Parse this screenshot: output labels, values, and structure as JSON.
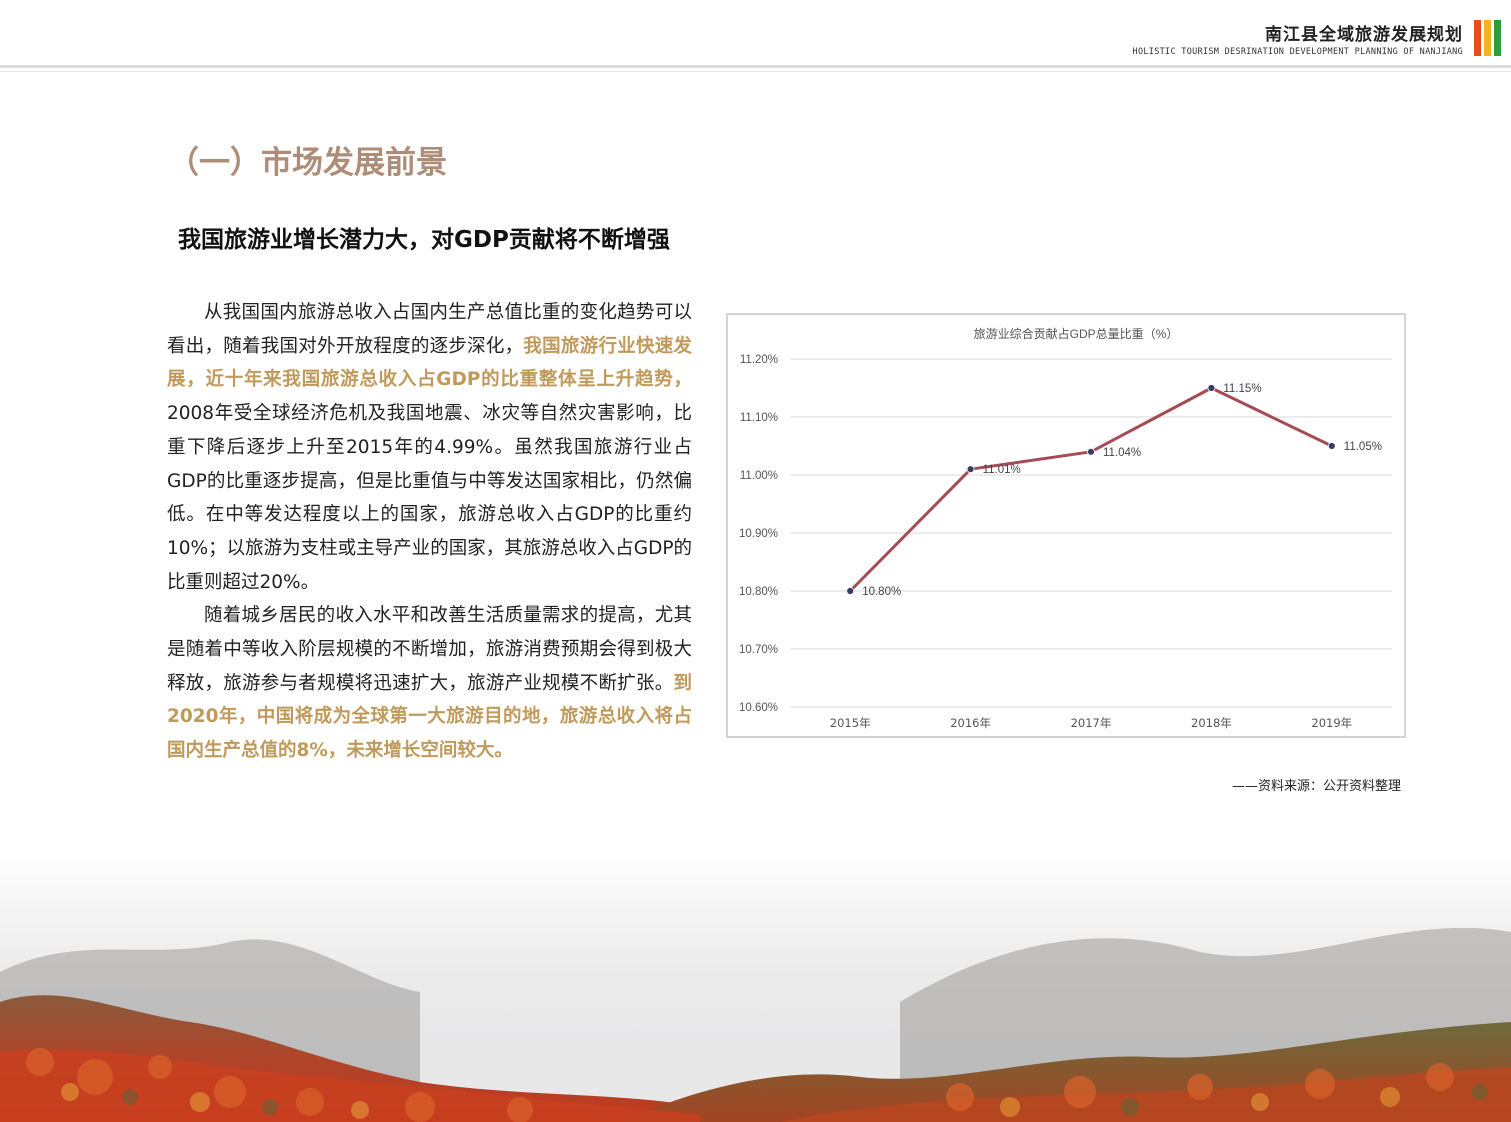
{
  "header": {
    "title": "南江县全域旅游发展规划",
    "subtitle": "HOLISTIC TOURISM DESRINATION DEVELOPMENT PLANNING OF NANJIANG",
    "bar_colors": [
      "#e74c1c",
      "#f4b120",
      "#2e9e3a"
    ]
  },
  "section_title": "（一）市场发展前景",
  "subheading": "我国旅游业增长潜力大，对GDP贡献将不断增强",
  "paragraph1": {
    "part1": "从我国国内旅游总收入占国内生产总值比重的变化趋势可以看出，随着我国对外开放程度的逐步深化，",
    "highlight": "我国旅游行业快速发展，近十年来我国旅游总收入占GDP的比重整体呈上升趋势，",
    "part2": "2008年受全球经济危机及我国地震、冰灾等自然灾害影响，比重下降后逐步上升至2015年的4.99%。虽然我国旅游行业占GDP的比重逐步提高，但是比重值与中等发达国家相比，仍然偏低。在中等发达程度以上的国家，旅游总收入占GDP的比重约10%；以旅游为支柱或主导产业的国家，其旅游总收入占GDP的比重则超过20%。"
  },
  "paragraph2": {
    "part1": "随着城乡居民的收入水平和改善生活质量需求的提高，尤其是随着中等收入阶层规模的不断增加，旅游消费预期会得到极大释放，旅游参与者规模将迅速扩大，旅游产业规模不断扩张。",
    "highlight": "到2020年，中国将成为全球第一大旅游目的地，旅游总收入将占国内生产总值的8%，未来增长空间较大。"
  },
  "source": "——资料来源：公开资料整理",
  "chart_data": {
    "type": "line",
    "title": "旅游业综合贡献占GDP总量比重（%）",
    "categories": [
      "2015年",
      "2016年",
      "2017年",
      "2018年",
      "2019年"
    ],
    "values": [
      10.8,
      11.01,
      11.04,
      11.15,
      11.05
    ],
    "data_labels": [
      "10.80%",
      "11.01%",
      "11.04%",
      "11.15%",
      "11.05%"
    ],
    "y_ticks": [
      "10.60%",
      "10.70%",
      "10.80%",
      "10.90%",
      "11.00%",
      "11.10%",
      "11.20%"
    ],
    "ylim": [
      10.6,
      11.2
    ],
    "y_step": 0.1,
    "grid": true,
    "line_color": "#a64a55",
    "marker_color": "#3a3a66",
    "xlabel": "",
    "ylabel": ""
  }
}
